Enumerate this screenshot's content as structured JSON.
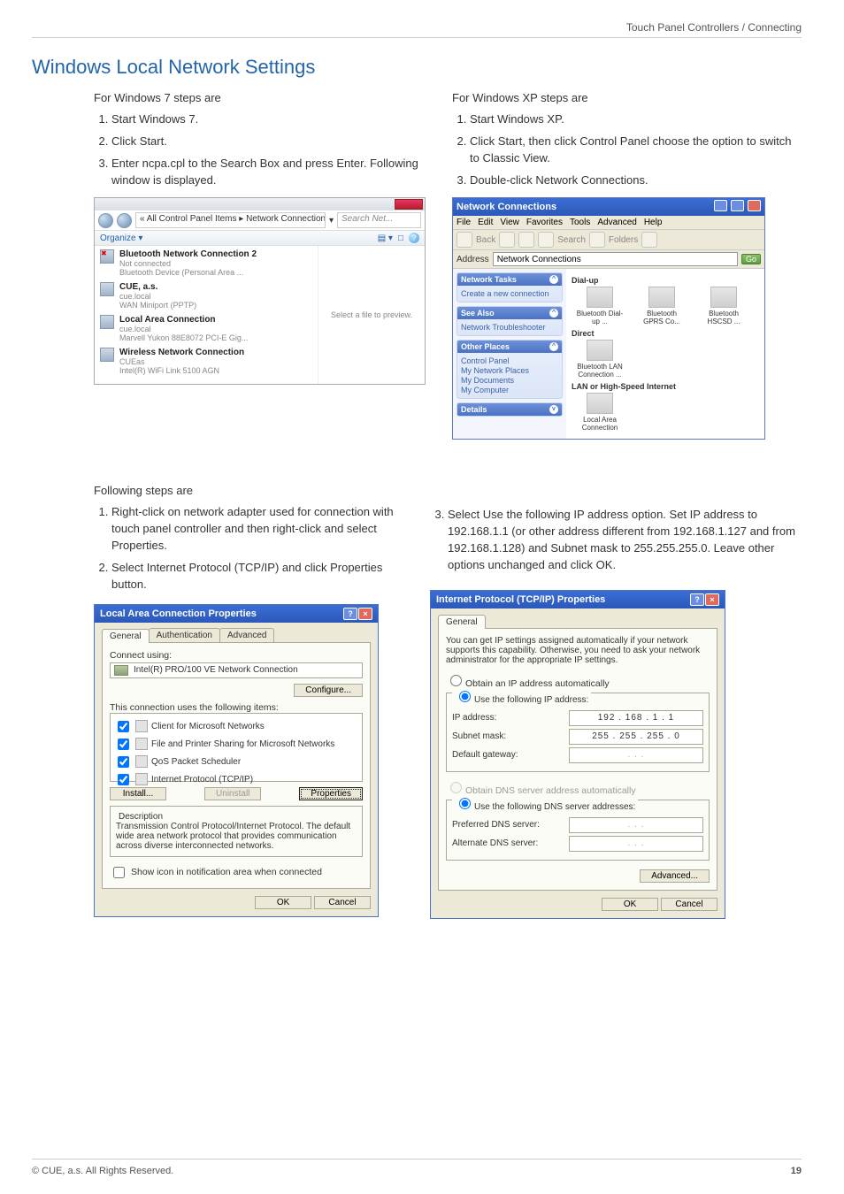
{
  "header": {
    "breadcrumb": "Touch Panel Controllers / Connecting"
  },
  "title": "Windows Local Network Settings",
  "col1": {
    "intro": "For Windows 7 steps are",
    "steps": [
      "Start Windows 7.",
      "Click Start.",
      "Enter ncpa.cpl to the Search Box and press Enter. Following window is displayed."
    ],
    "win7": {
      "crumb": "« All Control Panel Items ▸ Network Connections ▸",
      "search_placeholder": "Search Net...",
      "organize": "Organize ▾",
      "preview_msg": "Select a file to preview.",
      "items": [
        {
          "title": "Bluetooth Network Connection 2",
          "sub1": "Not connected",
          "sub2": "Bluetooth Device (Personal Area ..."
        },
        {
          "title": "CUE, a.s.",
          "sub1": "cue.local",
          "sub2": "WAN Miniport (PPTP)"
        },
        {
          "title": "Local Area Connection",
          "sub1": "cue.local",
          "sub2": "Marvell Yukon 88E8072 PCI-E Gig..."
        },
        {
          "title": "Wireless Network Connection",
          "sub1": "CUEas",
          "sub2": "Intel(R) WiFi Link 5100 AGN"
        }
      ]
    },
    "followIntro": "Following steps are",
    "followSteps": [
      "Right-click on network adapter used for connection with touch panel controller and then right-click and select Properties.",
      "Select Internet Protocol (TCP/IP) and click Properties button."
    ]
  },
  "col2": {
    "intro": "For Windows XP steps are",
    "steps": [
      "Start Windows XP.",
      "Click Start, then click Control Panel choose the option to switch to Classic View.",
      "Double-click Network Connections."
    ],
    "xp": {
      "title": "Network Connections",
      "menu": [
        "File",
        "Edit",
        "View",
        "Favorites",
        "Tools",
        "Advanced",
        "Help"
      ],
      "tb_back": "Back",
      "tb_search": "Search",
      "tb_folders": "Folders",
      "addr_label": "Address",
      "addr_value": "Network Connections",
      "go": "Go",
      "side": {
        "tasks": {
          "title": "Network Tasks",
          "items": [
            "Create a new connection"
          ]
        },
        "see": {
          "title": "See Also",
          "items": [
            "Network Troubleshooter"
          ]
        },
        "other": {
          "title": "Other Places",
          "items": [
            "Control Panel",
            "My Network Places",
            "My Documents",
            "My Computer"
          ]
        },
        "details": {
          "title": "Details"
        }
      },
      "main": {
        "g1": "Dial-up",
        "g1items": [
          "Bluetooth Dial-up ...",
          "Bluetooth GPRS Co...",
          "Bluetooth HSCSD ..."
        ],
        "g2": "Direct",
        "g2items": [
          "Bluetooth LAN Connection ..."
        ],
        "g3": "LAN or High-Speed Internet",
        "g3items": [
          "Local Area Connection"
        ]
      }
    },
    "step3": "Select Use the following IP address option. Set IP address to 192.168.1.1 (or other address different from 192.168.1.127 and from 192.168.1.128) and Subnet mask to 255.255.255.0. Leave other options unchanged and click OK."
  },
  "lacDialog": {
    "title": "Local Area Connection Properties",
    "tabs": [
      "General",
      "Authentication",
      "Advanced"
    ],
    "connect_using": "Connect using:",
    "adapter": "Intel(R) PRO/100 VE Network Connection",
    "configure": "Configure...",
    "uses": "This connection uses the following items:",
    "items": [
      "Client for Microsoft Networks",
      "File and Printer Sharing for Microsoft Networks",
      "QoS Packet Scheduler",
      "Internet Protocol (TCP/IP)"
    ],
    "install": "Install...",
    "uninstall": "Uninstall",
    "properties": "Properties",
    "desc_label": "Description",
    "desc_text": "Transmission Control Protocol/Internet Protocol. The default wide area network protocol that provides communication across diverse interconnected networks.",
    "show_icon": "Show icon in notification area when connected",
    "ok": "OK",
    "cancel": "Cancel"
  },
  "ipDialog": {
    "title": "Internet Protocol (TCP/IP) Properties",
    "tab": "General",
    "blurb": "You can get IP settings assigned automatically if your network supports this capability. Otherwise, you need to ask your network administrator for the appropriate IP settings.",
    "r1": "Obtain an IP address automatically",
    "r2": "Use the following IP address:",
    "ip_label": "IP address:",
    "ip_value": "192 . 168 .   1  .   1",
    "mask_label": "Subnet mask:",
    "mask_value": "255 . 255 . 255 .   0",
    "gw_label": "Default gateway:",
    "gw_value": ".        .        .",
    "r3": "Obtain DNS server address automatically",
    "r4": "Use the following DNS server addresses:",
    "pdns_label": "Preferred DNS server:",
    "pdns_value": ".        .        .",
    "adns_label": "Alternate DNS server:",
    "adns_value": ".        .        .",
    "advanced": "Advanced...",
    "ok": "OK",
    "cancel": "Cancel"
  },
  "footer": {
    "copyright": "© CUE, a.s. All Rights Reserved.",
    "page": "19"
  }
}
